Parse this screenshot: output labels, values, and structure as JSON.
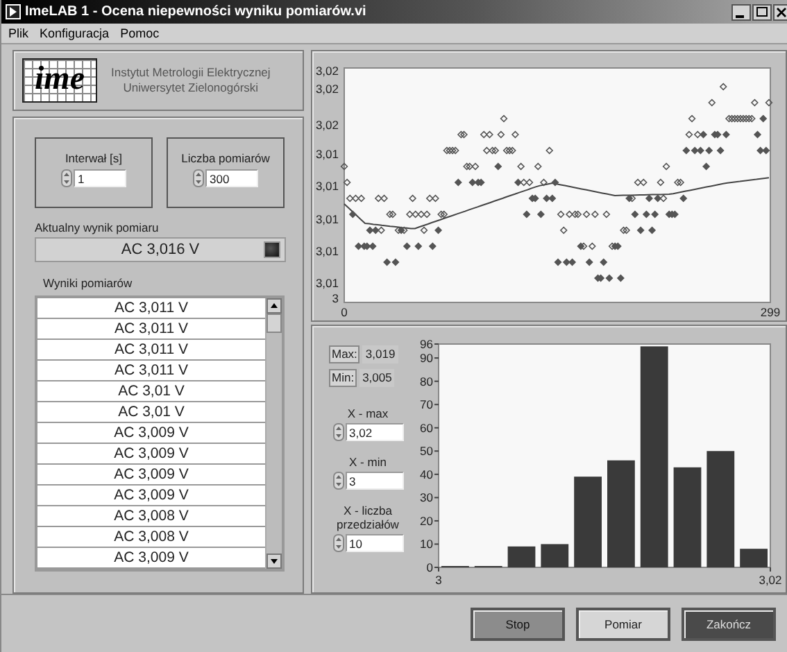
{
  "window": {
    "title": "ImeLAB 1 - Ocena niepewności wyniku pomiarów.vi"
  },
  "menu": [
    "Plik",
    "Konfiguracja",
    "Pomoc"
  ],
  "header": {
    "logo_text": "ime",
    "institute": "Instytut Metrologii Elektrycznej",
    "university": "Uniwersytet Zielonogórski"
  },
  "controls": [
    {
      "label": "Interwał [s]",
      "value": "1"
    },
    {
      "label": "Liczba pomiarów",
      "value": "300"
    }
  ],
  "current": {
    "label": "Aktualny wynik pomiaru",
    "value": "AC 3,016 V",
    "indicator_on": false
  },
  "results": {
    "label": "Wyniki pomiarów",
    "rows": [
      "AC 3,011 V",
      "AC 3,011 V",
      "AC 3,011 V",
      "AC 3,011 V",
      "AC 3,01 V",
      "AC 3,01 V",
      "AC 3,009 V",
      "AC 3,009 V",
      "AC 3,009 V",
      "AC 3,009 V",
      "AC 3,008 V",
      "AC 3,008 V",
      "AC 3,009 V"
    ]
  },
  "time_chart": {
    "y_tick_labels": [
      "3,02",
      "3,02",
      "3,02",
      "3,01",
      "3,01",
      "3,01",
      "3,01",
      "3,01",
      "3"
    ],
    "x_tick_labels": [
      "0",
      "299"
    ]
  },
  "stats": [
    {
      "label": "Max:",
      "value": "3,019"
    },
    {
      "label": "Min:",
      "value": "3,005"
    }
  ],
  "limits": [
    {
      "label": "X - max",
      "value": "3,02"
    },
    {
      "label": "X - min",
      "value": "3"
    },
    {
      "label": "X - liczba przedziałów",
      "value": "10"
    }
  ],
  "histogram": {
    "chart_data": {
      "type": "bar",
      "x": [
        3.001,
        3.003,
        3.005,
        3.007,
        3.009,
        3.011,
        3.013,
        3.015,
        3.017,
        3.019
      ],
      "values": [
        0,
        0,
        9,
        10,
        39,
        46,
        95,
        43,
        50,
        8
      ],
      "xlim": [
        3,
        3.02
      ],
      "ylim": [
        0,
        96
      ],
      "xticks": [
        {
          "value": 3,
          "label": "3"
        },
        {
          "value": 3.02,
          "label": "3,02"
        }
      ],
      "yticks": [
        0,
        10,
        20,
        30,
        40,
        50,
        60,
        70,
        80,
        90,
        96
      ]
    }
  },
  "buttons": [
    {
      "label": "Stop",
      "kind": "mid"
    },
    {
      "label": "Pomiar",
      "kind": "light"
    },
    {
      "label": "Zakończ",
      "kind": "dark"
    }
  ]
}
